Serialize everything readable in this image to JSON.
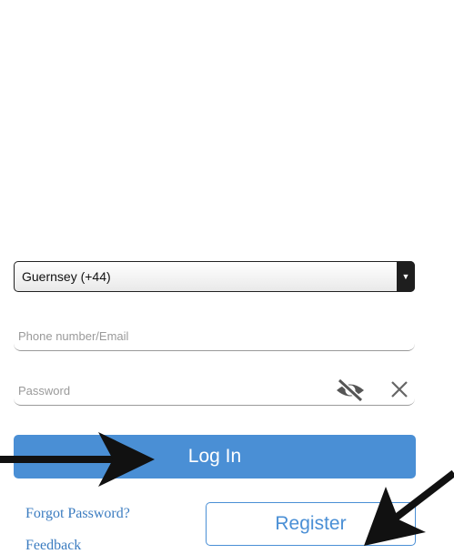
{
  "country_select": {
    "value": "Guernsey (+44)"
  },
  "phone_field": {
    "placeholder": "Phone number/Email"
  },
  "password_field": {
    "placeholder": "Password"
  },
  "buttons": {
    "login_label": "Log In",
    "register_label": "Register"
  },
  "links": {
    "forgot_password": "Forgot Password?",
    "feedback": "Feedback"
  },
  "icons": {
    "dropdown": "triangle-down-icon",
    "visibility": "eye-slash-icon",
    "clear": "close-icon",
    "annotation": "arrow-icon"
  },
  "colors": {
    "accent": "#4a8fd5",
    "link": "#3b7cc0",
    "dropdown_button": "#1e1e1e",
    "annotation_arrow": "#111111"
  }
}
